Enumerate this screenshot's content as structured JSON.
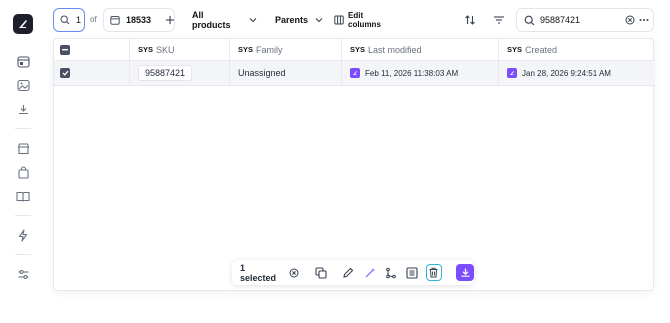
{
  "toolbar": {
    "search_count": "1",
    "of_label": "of",
    "total_count": "18533",
    "products_filter": "All products",
    "parents_filter": "Parents",
    "edit_columns": "Edit columns",
    "search_value": "95887421"
  },
  "columns": [
    {
      "prefix": "SYS",
      "label": "SKU"
    },
    {
      "prefix": "SYS",
      "label": "Family"
    },
    {
      "prefix": "SYS",
      "label": "Last modified"
    },
    {
      "prefix": "SYS",
      "label": "Created"
    }
  ],
  "rows": [
    {
      "sku": "95887421",
      "family": "Unassigned",
      "last_modified": "Feb 11, 2026 11:38:03 AM",
      "created": "Jan 28, 2026 9:24:51 AM"
    }
  ],
  "selection": {
    "label": "1 selected"
  },
  "colors": {
    "accent": "#7c4dff",
    "focus_ring": "#2fb8d6",
    "row_selected_bg": "#f4f5f8"
  },
  "icons": {
    "sidebar": [
      "app-logo-icon",
      "calendar-icon",
      "image-icon",
      "download-icon",
      "store-icon",
      "bag-icon",
      "book-icon",
      "lightning-icon",
      "sliders-icon"
    ],
    "actions": [
      "clear-selection-icon",
      "duplicate-icon",
      "edit-icon",
      "magic-wand-icon",
      "hierarchy-icon",
      "list-icon",
      "trash-icon",
      "download-icon"
    ]
  }
}
